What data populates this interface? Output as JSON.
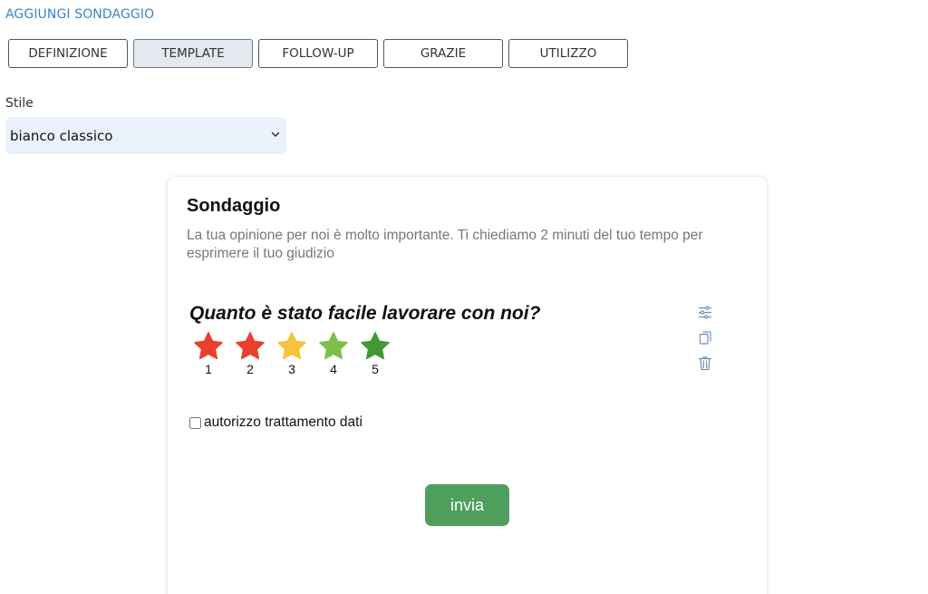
{
  "page": {
    "title": "AGGIUNGI SONDAGGIO"
  },
  "tabs": [
    {
      "label": "DEFINIZIONE",
      "active": false
    },
    {
      "label": "TEMPLATE",
      "active": true
    },
    {
      "label": "FOLLOW-UP",
      "active": false
    },
    {
      "label": "GRAZIE",
      "active": false
    },
    {
      "label": "UTILIZZO",
      "active": false
    }
  ],
  "style_field": {
    "label": "Stile",
    "value": "bianco classico"
  },
  "survey": {
    "title": "Sondaggio",
    "description": "La tua opinione per noi è molto importante. Ti chiediamo 2 minuti del tuo tempo per esprimere il tuo giudizio",
    "question": {
      "text": "Quanto è stato facile lavorare con noi?",
      "ratings": [
        {
          "label": "1",
          "color": "#e8402c"
        },
        {
          "label": "2",
          "color": "#e8402c"
        },
        {
          "label": "3",
          "color": "#f7c23d"
        },
        {
          "label": "4",
          "color": "#7dc04a"
        },
        {
          "label": "5",
          "color": "#3f9a36"
        }
      ],
      "tools": [
        "sliders-icon",
        "copy-icon",
        "trash-icon"
      ]
    },
    "consent_label": "autorizzo trattamento dati",
    "consent_checked": false,
    "submit_label": "invia"
  },
  "colors": {
    "accent": "#3a86c8",
    "submit": "#4f9e5b",
    "tool_icon": "#6f8fbf",
    "select_bg": "#eaf1fb"
  }
}
